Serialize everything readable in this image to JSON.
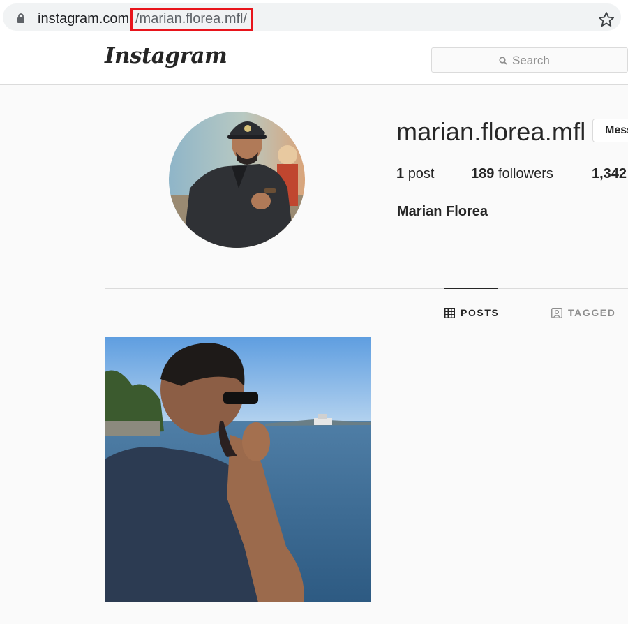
{
  "browser": {
    "url_host": "instagram.com",
    "url_path": "/marian.florea.mfl/",
    "highlight_color": "#e8141b"
  },
  "header": {
    "logo": "Instagram",
    "search_placeholder": "Search"
  },
  "profile": {
    "username": "marian.florea.mfl",
    "message_button": "Message",
    "posts_count": "1",
    "posts_label": "post",
    "followers_count": "189",
    "followers_label": "followers",
    "following_count": "1,342",
    "full_name": "Marian Florea"
  },
  "tabs": [
    {
      "label": "POSTS",
      "icon": "grid-icon",
      "active": true
    },
    {
      "label": "TAGGED",
      "icon": "tag-portrait-icon",
      "active": false
    }
  ],
  "colors": {
    "accent_text": "#262626",
    "muted_text": "#8e8e8e",
    "border": "#dbdbdb"
  }
}
